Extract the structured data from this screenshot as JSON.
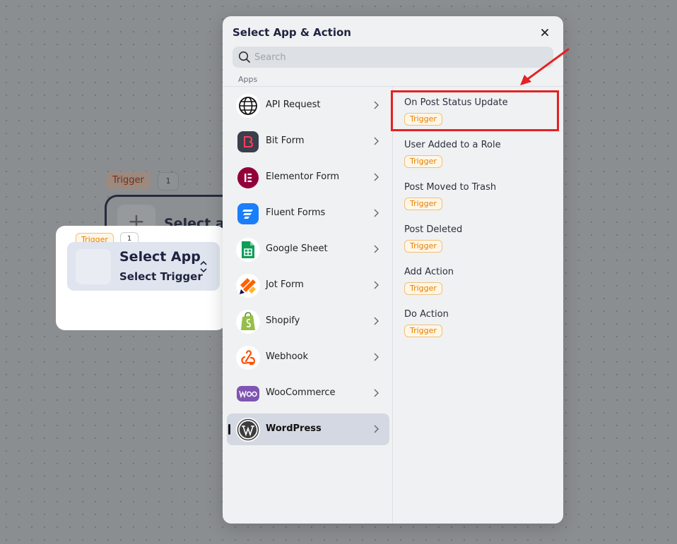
{
  "canvas": {
    "bg_node": {
      "badge": "Trigger",
      "count": "1",
      "text": "Select ap"
    },
    "trigger_card": {
      "badge": "Trigger",
      "count": "1",
      "app_label": "Select App",
      "trigger_label": "Select Trigger"
    }
  },
  "modal": {
    "title": "Select App & Action",
    "close_icon": "close-icon",
    "search": {
      "placeholder": "Search",
      "value": ""
    },
    "section_label": "Apps",
    "apps": [
      {
        "label": "API Request",
        "icon": "globe-icon"
      },
      {
        "label": "Bit Form",
        "icon": "bit-form-icon"
      },
      {
        "label": "Elementor Form",
        "icon": "elementor-icon"
      },
      {
        "label": "Fluent Forms",
        "icon": "fluent-forms-icon"
      },
      {
        "label": "Google Sheet",
        "icon": "google-sheet-icon"
      },
      {
        "label": "Jot Form",
        "icon": "jotform-icon"
      },
      {
        "label": "Shopify",
        "icon": "shopify-icon"
      },
      {
        "label": "Webhook",
        "icon": "webhook-icon"
      },
      {
        "label": "WooCommerce",
        "icon": "woocommerce-icon"
      },
      {
        "label": "WordPress",
        "icon": "wordpress-icon",
        "active": true
      }
    ],
    "triggers": [
      {
        "name": "On Post Status Update",
        "badge": "Trigger",
        "highlighted": true
      },
      {
        "name": "User Added to a Role",
        "badge": "Trigger"
      },
      {
        "name": "Post Moved to Trash",
        "badge": "Trigger"
      },
      {
        "name": "Post Deleted",
        "badge": "Trigger"
      },
      {
        "name": "Add Action",
        "badge": "Trigger"
      },
      {
        "name": "Do Action",
        "badge": "Trigger"
      }
    ]
  },
  "colors": {
    "accent_text": "#1f2340",
    "trigger_badge": "#e67e00",
    "annotation": "#e32222",
    "active_row": "#d3d8e2"
  }
}
